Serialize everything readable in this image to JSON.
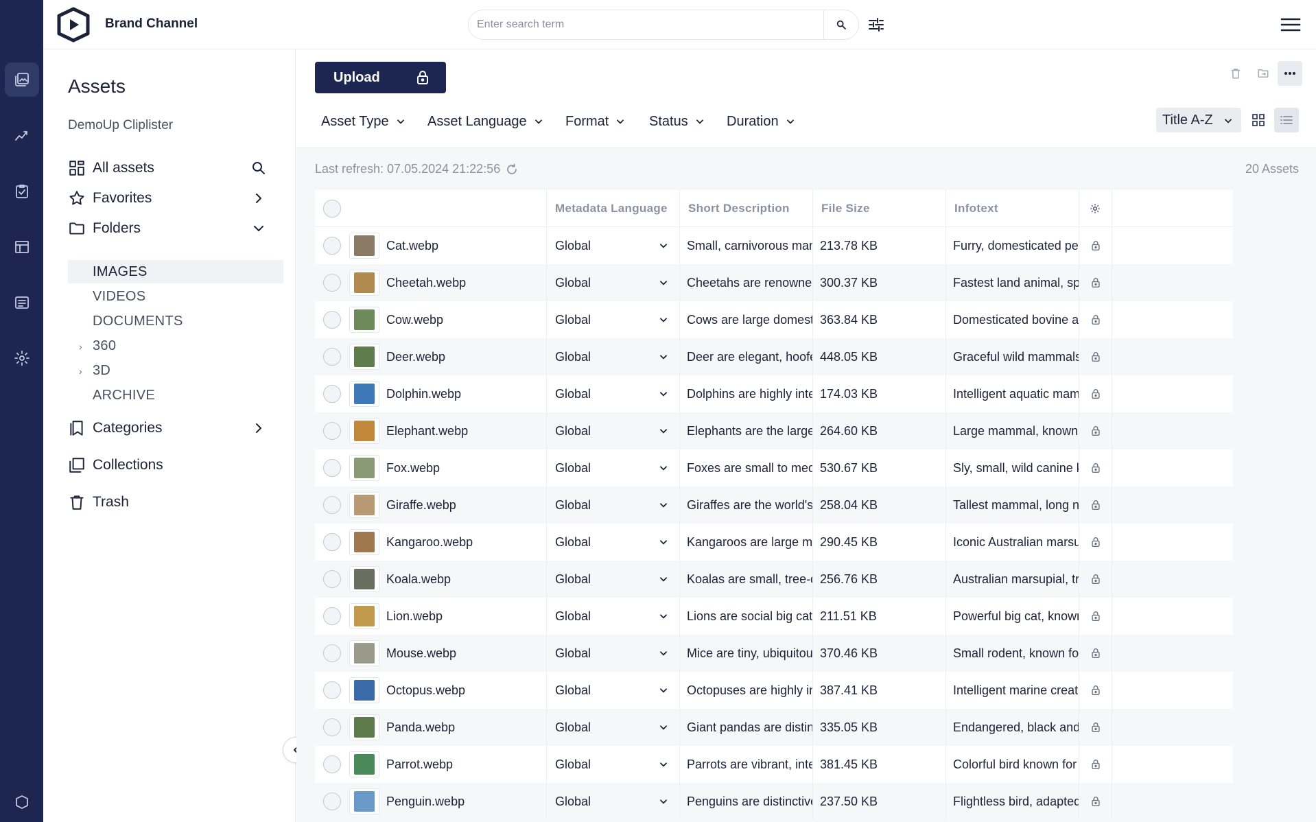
{
  "app": {
    "brand": "Brand Channel"
  },
  "search": {
    "placeholder": "Enter search term",
    "value": ""
  },
  "sidebar": {
    "title": "Assets",
    "subtitle": "DemoUp Cliplister",
    "nav": {
      "all_assets": "All assets",
      "favorites": "Favorites",
      "folders": "Folders",
      "categories": "Categories",
      "collections": "Collections",
      "trash": "Trash"
    },
    "folders": [
      "IMAGES",
      "VIDEOS",
      "DOCUMENTS",
      "360",
      "3D",
      "ARCHIVE"
    ]
  },
  "toolbar": {
    "upload": "Upload",
    "filters": [
      "Asset Type",
      "Asset Language",
      "Format",
      "Status",
      "Duration"
    ],
    "sort": "Title A-Z"
  },
  "status": {
    "last_refresh": "Last refresh: 07.05.2024 21:22:56",
    "count": "20 Assets"
  },
  "table": {
    "columns": [
      "Metadata Language",
      "Short Description",
      "File Size",
      "Infotext"
    ],
    "rows": [
      {
        "name": "Cat.webp",
        "lang": "Global",
        "desc": "Small, carnivorous mamm...",
        "size": "213.78 KB",
        "info": "Furry, domesticated pet k...",
        "color": "#8a7a66"
      },
      {
        "name": "Cheetah.webp",
        "lang": "Global",
        "desc": "Cheetahs are renowned fo...",
        "size": "300.37 KB",
        "info": "Fastest land animal, spotte...",
        "color": "#b08a4e"
      },
      {
        "name": "Cow.webp",
        "lang": "Global",
        "desc": "Cows are large domesticat...",
        "size": "363.84 KB",
        "info": "Domesticated bovine ani...",
        "color": "#6f8a5a"
      },
      {
        "name": "Deer.webp",
        "lang": "Global",
        "desc": "Deer are elegant, hoofed ...",
        "size": "448.05 KB",
        "info": "Graceful wild mammals wi...",
        "color": "#5f7d4c"
      },
      {
        "name": "Dolphin.webp",
        "lang": "Global",
        "desc": "Dolphins are highly intellig...",
        "size": "174.03 KB",
        "info": "Intelligent aquatic mamm...",
        "color": "#3f78b8"
      },
      {
        "name": "Elephant.webp",
        "lang": "Global",
        "desc": "Elephants are the largest l...",
        "size": "264.60 KB",
        "info": "Large mammal, known for ...",
        "color": "#c2883c"
      },
      {
        "name": "Fox.webp",
        "lang": "Global",
        "desc": "Foxes are small to medium...",
        "size": "530.67 KB",
        "info": "Sly, small, wild canine kno...",
        "color": "#8a9a76"
      },
      {
        "name": "Giraffe.webp",
        "lang": "Global",
        "desc": "Giraffes are the world's tall...",
        "size": "258.04 KB",
        "info": "Tallest mammal, long neck...",
        "color": "#b89a72"
      },
      {
        "name": "Kangaroo.webp",
        "lang": "Global",
        "desc": "Kangaroos are large marsu...",
        "size": "290.45 KB",
        "info": "Iconic Australian marsupial...",
        "color": "#a07850"
      },
      {
        "name": "Koala.webp",
        "lang": "Global",
        "desc": "Koalas are small, tree-dwel...",
        "size": "256.76 KB",
        "info": "Australian marsupial, tree-...",
        "color": "#6a6e5e"
      },
      {
        "name": "Lion.webp",
        "lang": "Global",
        "desc": "Lions are social big cats, fa...",
        "size": "211.51 KB",
        "info": "Powerful big cat, known f...",
        "color": "#c09a4a"
      },
      {
        "name": "Mouse.webp",
        "lang": "Global",
        "desc": "Mice are tiny, ubiquitous r...",
        "size": "370.46 KB",
        "info": "Small rodent, known for it...",
        "color": "#9a9a8a"
      },
      {
        "name": "Octopus.webp",
        "lang": "Global",
        "desc": "Octopuses are highly intell...",
        "size": "387.41 KB",
        "info": "Intelligent marine creature...",
        "color": "#3a6aa8"
      },
      {
        "name": "Panda.webp",
        "lang": "Global",
        "desc": "Giant pandas are distinctiv...",
        "size": "335.05 KB",
        "info": "Endangered, black and wh...",
        "color": "#5d7a4a"
      },
      {
        "name": "Parrot.webp",
        "lang": "Global",
        "desc": "Parrots are vibrant, intellig...",
        "size": "381.45 KB",
        "info": "Colorful bird known for mi...",
        "color": "#4a8a5a"
      },
      {
        "name": "Penguin.webp",
        "lang": "Global",
        "desc": "Penguins are distinctive, fli...",
        "size": "237.50 KB",
        "info": "Flightless bird, adapted for...",
        "color": "#6a9ac8"
      }
    ]
  }
}
